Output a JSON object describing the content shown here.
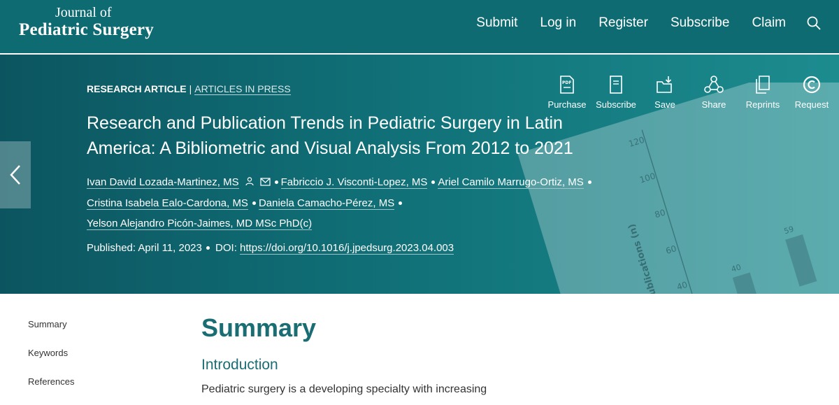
{
  "journal": {
    "line1": "Journal of",
    "line2": "Pediatric Surgery"
  },
  "nav": {
    "submit": "Submit",
    "login": "Log in",
    "register": "Register",
    "subscribe": "Subscribe",
    "claim": "Claim",
    "search_icon": "search-icon"
  },
  "article": {
    "type": "RESEARCH ARTICLE",
    "separator": "|",
    "section": "ARTICLES IN PRESS",
    "title": "Research and Publication Trends in Pediatric Surgery in Latin America: A Bibliometric and Visual Analysis From 2012 to 2021",
    "authors": [
      "Ivan David Lozada-Martinez, MS",
      "Fabriccio J. Visconti-Lopez, MS",
      "Ariel Camilo Marrugo-Ortiz, MS",
      "Cristina Isabela Ealo-Cardona, MS",
      "Daniela Camacho-Pérez, MS",
      "Yelson Alejandro Picón-Jaimes, MD MSc PhD(c)"
    ],
    "published_label": "Published:",
    "published_date": "April 11, 2023",
    "doi_label": "DOI:",
    "doi": "https://doi.org/10.1016/j.jpedsurg.2023.04.003"
  },
  "tools": [
    {
      "label": "Purchase",
      "icon": "pdf-icon"
    },
    {
      "label": "Subscribe",
      "icon": "journal-icon"
    },
    {
      "label": "Save",
      "icon": "folder-save-icon"
    },
    {
      "label": "Share",
      "icon": "share-icon"
    },
    {
      "label": "Reprints",
      "icon": "reprints-icon"
    },
    {
      "label": "Request",
      "icon": "copyright-icon"
    }
  ],
  "sidebar": {
    "items": [
      "Summary",
      "Keywords",
      "References"
    ]
  },
  "content": {
    "heading": "Summary",
    "subheading": "Introduction",
    "paragraph": "Pediatric surgery is a developing specialty with increasing"
  },
  "background_figure": {
    "ylabel": "Publications (n)",
    "ticks": [
      "120",
      "100",
      "80",
      "60",
      "40"
    ],
    "bar_labels": [
      "40",
      "59"
    ]
  },
  "colors": {
    "brand": "#0f6b72",
    "heading": "#1a6e73"
  }
}
